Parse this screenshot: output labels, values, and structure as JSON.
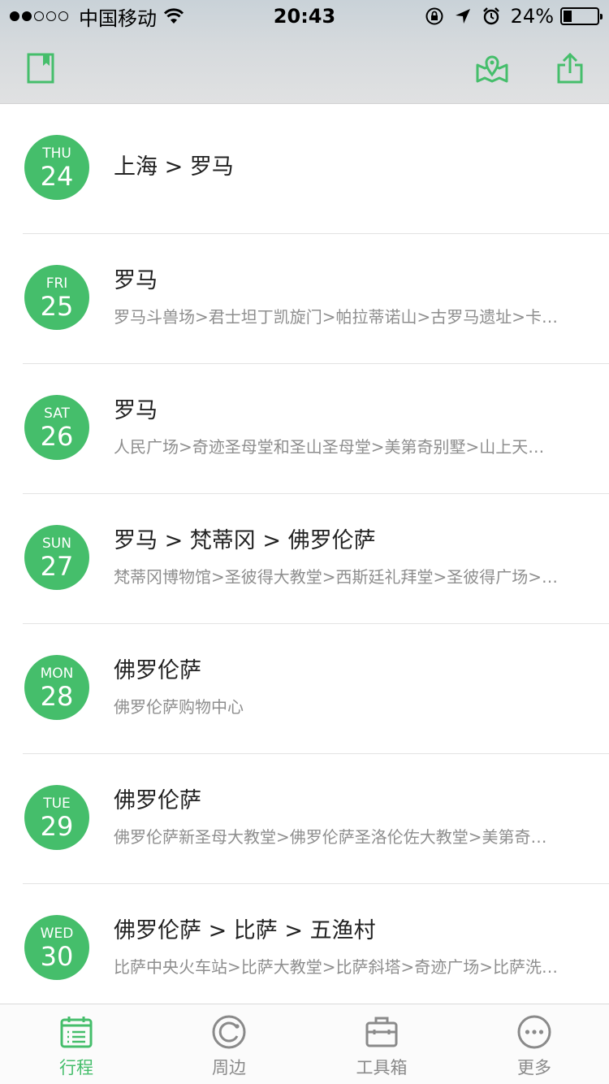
{
  "status_bar": {
    "signal_dots": [
      true,
      true,
      false,
      false,
      false
    ],
    "carrier": "中国移动",
    "time": "20:43",
    "battery_text": "24%",
    "battery_level": 0.24
  },
  "nav": {
    "left_icon": "bookmark-icon",
    "right_icons": [
      "map-icon",
      "share-icon"
    ]
  },
  "itinerary": [
    {
      "dow": "THU",
      "day": "24",
      "title": "上海 > 罗马",
      "sub": ""
    },
    {
      "dow": "FRI",
      "day": "25",
      "title": "罗马",
      "sub": "罗马斗兽场>君士坦丁凯旋门>帕拉蒂诺山>古罗马遗址>卡…"
    },
    {
      "dow": "SAT",
      "day": "26",
      "title": "罗马",
      "sub": "人民广场>奇迹圣母堂和圣山圣母堂>美第奇别墅>山上天…"
    },
    {
      "dow": "SUN",
      "day": "27",
      "title": "罗马 > 梵蒂冈 > 佛罗伦萨",
      "sub": "梵蒂冈博物馆>圣彼得大教堂>西斯廷礼拜堂>圣彼得广场>…"
    },
    {
      "dow": "MON",
      "day": "28",
      "title": "佛罗伦萨",
      "sub": "佛罗伦萨购物中心"
    },
    {
      "dow": "TUE",
      "day": "29",
      "title": "佛罗伦萨",
      "sub": "佛罗伦萨新圣母大教堂>佛罗伦萨圣洛伦佐大教堂>美第奇…"
    },
    {
      "dow": "WED",
      "day": "30",
      "title": "佛罗伦萨 > 比萨 > 五渔村",
      "sub": "比萨中央火车站>比萨大教堂>比萨斜塔>奇迹广场>比萨洗…"
    }
  ],
  "tabs": [
    {
      "label": "行程",
      "icon": "itinerary-icon",
      "active": true
    },
    {
      "label": "周边",
      "icon": "nearby-icon",
      "active": false
    },
    {
      "label": "工具箱",
      "icon": "toolbox-icon",
      "active": false
    },
    {
      "label": "更多",
      "icon": "more-icon",
      "active": false
    }
  ],
  "colors": {
    "accent": "#45be6b",
    "subtext": "#8e8e8e",
    "tab_inactive": "#8a8a8a"
  }
}
